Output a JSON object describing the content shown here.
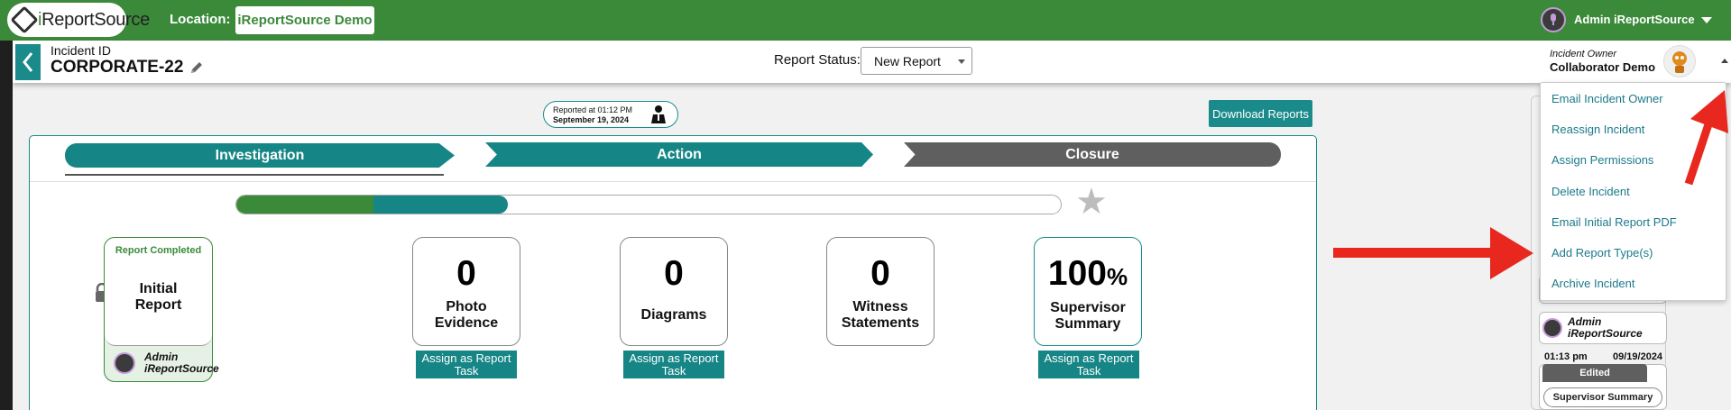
{
  "topbar": {
    "logo_text_prefix": "i",
    "logo_text_rest": "ReportSource",
    "location_label": "Location:",
    "location_value": "iReportSource Demo",
    "user_name": "Admin iReportSource"
  },
  "header": {
    "incident_label": "Incident ID",
    "incident_id": "CORPORATE-22",
    "status_label": "Report Status:",
    "status_value": "New Report",
    "owner_label": "Incident Owner",
    "owner_name": "Collaborator Demo"
  },
  "reported": {
    "line1": "Reported at 01:12 PM",
    "line2": "September 19, 2024"
  },
  "download_label": "Download Reports",
  "stages": [
    "Investigation",
    "Action",
    "Closure"
  ],
  "progress": {
    "green_fraction": 0.166,
    "teal_fraction": 0.163
  },
  "initial_report": {
    "status": "Report Completed",
    "title_line1": "Initial",
    "title_line2": "Report",
    "user_line1": "Admin",
    "user_line2": "iReportSource"
  },
  "cards": [
    {
      "num": "0",
      "label_line1": "Photo",
      "label_line2": "Evidence",
      "assign": "Assign as Report Task"
    },
    {
      "num": "0",
      "label_line1": "Diagrams",
      "label_line2": "",
      "assign": "Assign as Report Task"
    },
    {
      "num": "0",
      "label_line1": "Witness",
      "label_line2": "Statements",
      "assign": ""
    },
    {
      "num": "100",
      "pct": "%",
      "label_line1": "Supervisor",
      "label_line2": "Summary",
      "assign": "Assign as Report Task"
    }
  ],
  "dropdown": [
    "Email Incident Owner",
    "Reassign Incident",
    "Assign Permissions",
    "Delete Incident",
    "Email Initial Report PDF",
    "Add Report Type(s)",
    "Archive Incident"
  ],
  "activity": {
    "user_line1": "Admin",
    "user_line2": "iReportSource",
    "time": "01:13 pm",
    "date": "09/19/2024",
    "edited": "Edited",
    "report": "Supervisor Summary"
  },
  "colors": {
    "brand_green": "#3a8a3a",
    "teal": "#168585",
    "gray": "#5f5f5f",
    "annotation_red": "#e8281e"
  }
}
